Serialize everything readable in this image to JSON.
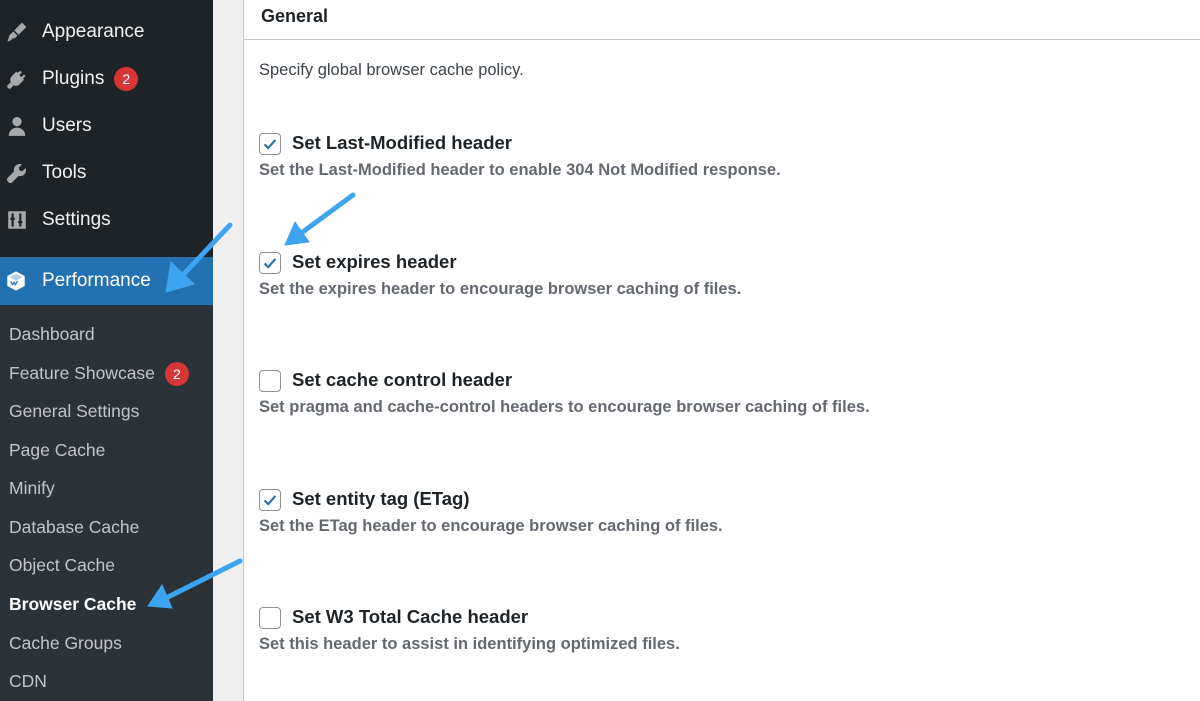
{
  "sidebar": {
    "items": [
      {
        "label": "Appearance",
        "icon": "paintbrush-icon"
      },
      {
        "label": "Plugins",
        "icon": "plug-icon",
        "badge": "2"
      },
      {
        "label": "Users",
        "icon": "user-icon"
      },
      {
        "label": "Tools",
        "icon": "wrench-icon"
      },
      {
        "label": "Settings",
        "icon": "sliders-icon"
      }
    ],
    "current": {
      "label": "Performance",
      "icon": "w3tc-cube-icon"
    },
    "submenu": [
      {
        "label": "Dashboard"
      },
      {
        "label": "Feature Showcase",
        "badge": "2"
      },
      {
        "label": "General Settings"
      },
      {
        "label": "Page Cache"
      },
      {
        "label": "Minify"
      },
      {
        "label": "Database Cache"
      },
      {
        "label": "Object Cache"
      },
      {
        "label": "Browser Cache",
        "active": true
      },
      {
        "label": "Cache Groups"
      },
      {
        "label": "CDN"
      }
    ]
  },
  "panel": {
    "title": "General",
    "intro": "Specify global browser cache policy.",
    "options": [
      {
        "label": "Set Last-Modified header",
        "description": "Set the Last-Modified header to enable 304 Not Modified response.",
        "checked": true
      },
      {
        "label": "Set expires header",
        "description": "Set the expires header to encourage browser caching of files.",
        "checked": true
      },
      {
        "label": "Set cache control header",
        "description": "Set pragma and cache-control headers to encourage browser caching of files.",
        "checked": false
      },
      {
        "label": "Set entity tag (ETag)",
        "description": "Set the ETag header to encourage browser caching of files.",
        "checked": true
      },
      {
        "label": "Set W3 Total Cache header",
        "description": "Set this header to assist in identifying optimized files.",
        "checked": false
      }
    ]
  },
  "colors": {
    "sidebar_bg": "#1d2327",
    "submenu_bg": "#2c3338",
    "accent": "#2271b1",
    "badge": "#d63638",
    "annotation_arrow": "#3fa4f0"
  }
}
